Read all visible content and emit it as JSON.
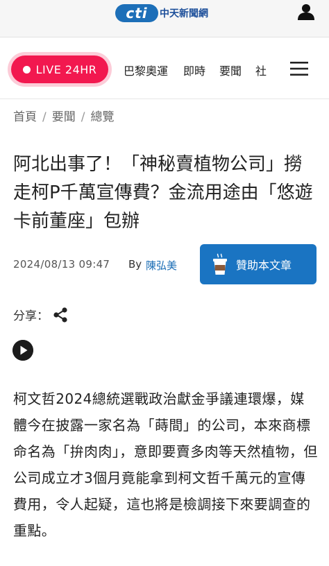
{
  "header": {
    "logo_mark": "cti",
    "logo_text": "中天新聞網"
  },
  "nav": {
    "live_label": "LIVE 24HR",
    "items": [
      "巴黎奧運",
      "即時",
      "要聞",
      "社"
    ]
  },
  "breadcrumb": [
    "首頁",
    "要聞",
    "總覽"
  ],
  "article": {
    "title": "阿北出事了！「神秘賣植物公司」撈走柯P千萬宣傳費？金流用途由「悠遊卡前董座」包辦",
    "date": "2024/08/13 09:47",
    "by": "By",
    "author": "陳弘美",
    "sponsor_label": "贊助本文章",
    "share_label": "分享：",
    "body": "柯文哲2024總統選戰政治獻金爭議連環爆，媒體今在披露一家名為「蒔間」的公司，本來商標命名為「拚肉肉」，意即要賣多肉等天然植物，但公司成立才3個月竟能拿到柯文哲千萬元的宣傳費用，令人起疑，這也將是檢調接下來要調查的重點。"
  },
  "colors": {
    "live_red": "#f2184f",
    "sponsor_blue": "#1a74c2",
    "author_blue": "#1a6db5"
  }
}
